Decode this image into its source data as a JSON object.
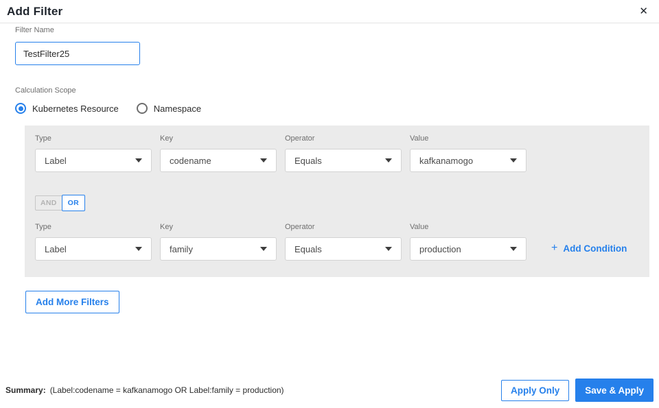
{
  "header": {
    "title": "Add Filter",
    "close_icon": "✕"
  },
  "filter_name": {
    "label": "Filter Name",
    "value": "TestFilter25"
  },
  "calculation_scope": {
    "label": "Calculation Scope",
    "options": [
      {
        "label": "Kubernetes Resource",
        "selected": true
      },
      {
        "label": "Namespace",
        "selected": false
      }
    ]
  },
  "conditions": {
    "columns": [
      "Type",
      "Key",
      "Operator",
      "Value"
    ],
    "rows": [
      {
        "type": "Label",
        "key": "codename",
        "operator": "Equals",
        "value": "kafkanamogo"
      },
      {
        "type": "Label",
        "key": "family",
        "operator": "Equals",
        "value": "production"
      }
    ],
    "logic_toggle": {
      "and_label": "AND",
      "or_label": "OR",
      "selected": "OR"
    },
    "add_condition": {
      "plus_icon": "+",
      "label": "Add Condition"
    }
  },
  "add_more_filters_label": "Add More Filters",
  "footer": {
    "summary_label": "Summary:",
    "summary_text": "(Label:codename = kafkanamogo OR Label:family = production)",
    "apply_only_label": "Apply Only",
    "save_apply_label": "Save & Apply"
  },
  "colors": {
    "accent_blue": "#2680eb",
    "panel_gray": "#ebebeb",
    "label_gray": "#6e6e6e"
  }
}
